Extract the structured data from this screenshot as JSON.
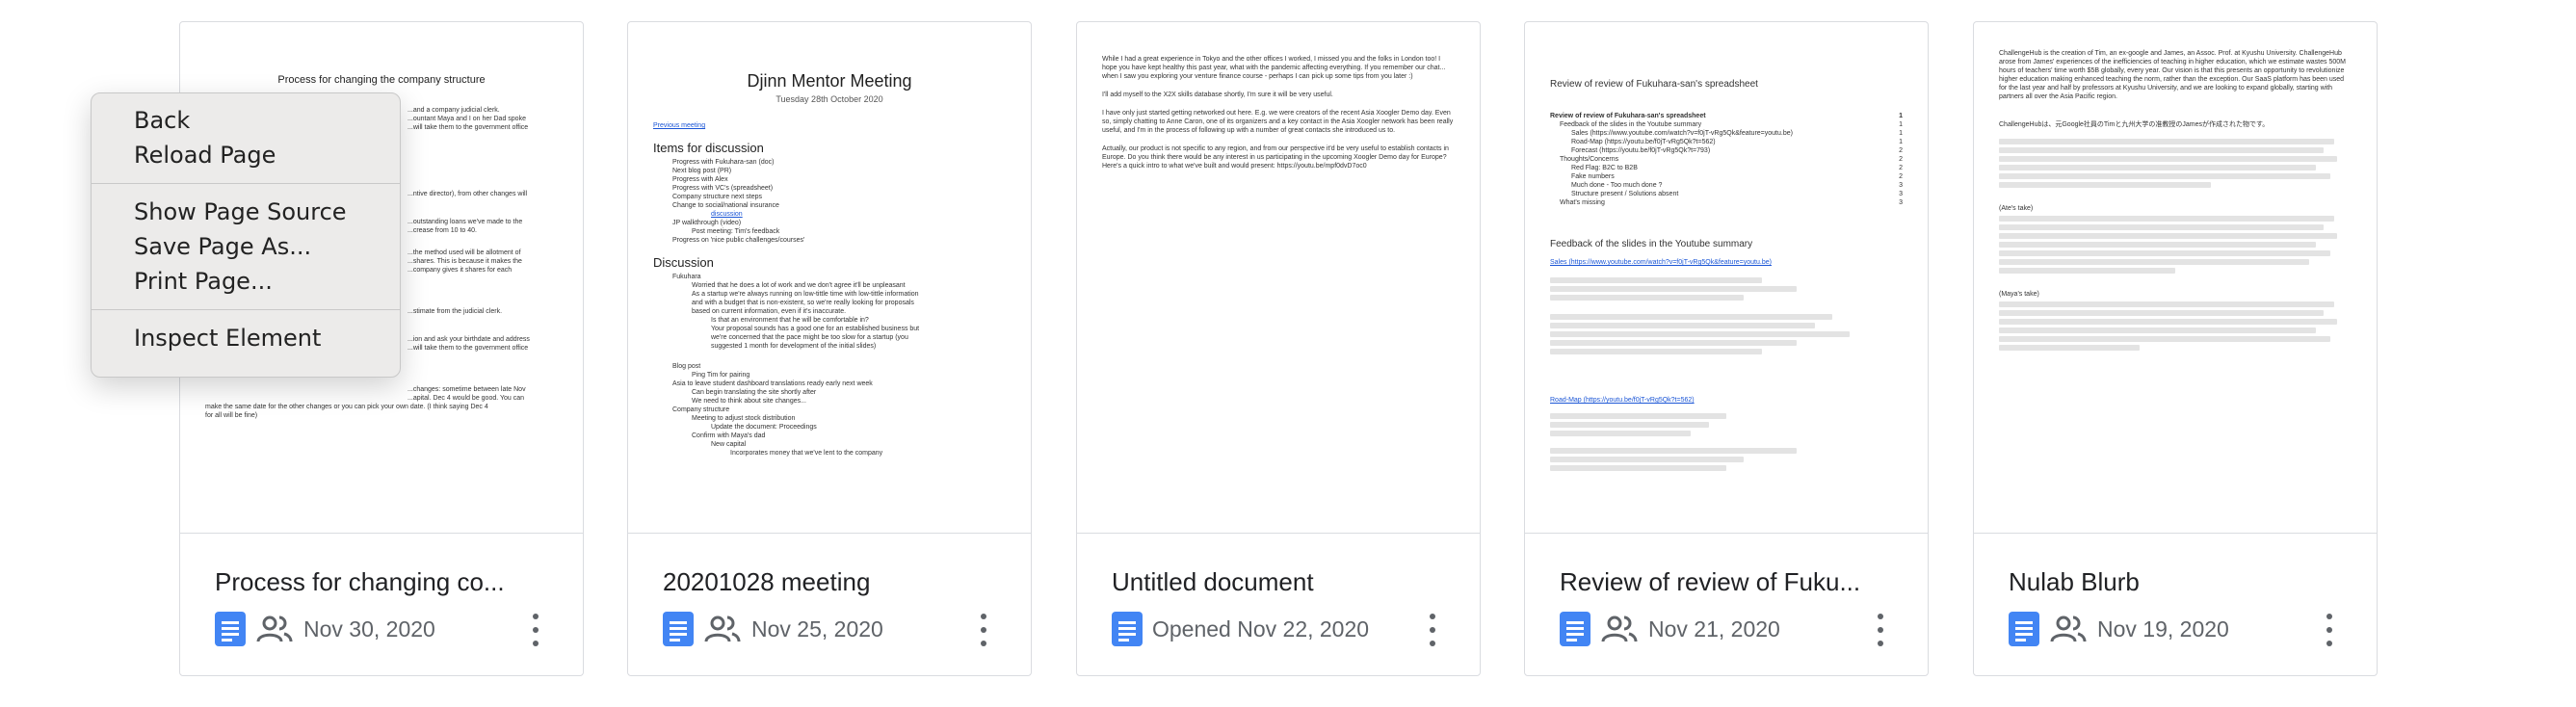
{
  "context_menu": {
    "items": [
      [
        "Back",
        "Reload Page"
      ],
      [
        "Show Page Source",
        "Save Page As...",
        "Print Page..."
      ],
      [
        "Inspect Element"
      ]
    ]
  },
  "cards": [
    {
      "title": "Process for changing co...",
      "shared": true,
      "meta": "Nov 30, 2020",
      "preview": {
        "title": "Process for changing the company structure",
        "lines": [
          "...and a company judicial clerk.",
          "...ountant Maya and I on her Dad spoke",
          "...will take them to the government office",
          "...ntive director), from other changes will",
          "...outstanding loans we've made to the",
          "...crease from 10 to 40.",
          "...the method used will be allotment of",
          "...shares. This is because it makes the",
          "...company gives it shares for each",
          "...stimate from the judicial clerk.",
          "...ion and ask your birthdate and address",
          "...will take them to the government office",
          "...changes: sometime between late Nov",
          "...apital. Dec 4 would be good. You can",
          "make the same date for the other changes or you can pick your own date. (I think saying Dec 4",
          "for all will be fine)"
        ]
      }
    },
    {
      "title": "20201028 meeting",
      "shared": true,
      "meta": "Nov 25, 2020",
      "preview": {
        "title": "Djinn Mentor Meeting",
        "subtitle": "Tuesday 28th October 2020",
        "link": "Previous meeting",
        "h1": "Items for discussion",
        "items": [
          "Progress with Fukuhara-san (doc)",
          "Next blog post (PR)",
          "Progress with Alex",
          "Progress with VC's (spreadsheet)",
          "Company structure next steps",
          "Change to social/national insurance",
          "discussion",
          "JP walkthrough (video)",
          "Post meeting: Tim's feedback",
          "Progress on 'nice public challenges/courses'"
        ],
        "h2": "Discussion",
        "discussion": [
          "Fukuhara",
          "Worried that he does a lot of work and we don't agree it'll be unpleasant",
          "As a startup we're always running on low-tittle time with low-tittle information",
          "and with a budget that is non-existent, so we're really looking for proposals",
          "based on current information, even if it's inaccurate.",
          "Is that an environment that he will be comfortable in?",
          "Your proposal sounds has a good one for an established business but",
          "we're concerned that the pace might be too slow for a startup (you",
          "suggested 1 month for development of the initial slides)",
          "Blog post",
          "Ping Tim for pairing",
          "Asia to leave student dashboard translations ready early next week",
          "Can begin translating the site shortly after",
          "We need to think about site changes...",
          "Company structure",
          "Meeting to adjust stock distribution",
          "Update the document: Proceedings",
          "Confirm with Maya's dad",
          "New capital",
          "Incorporates money that we've lent to the company"
        ]
      }
    },
    {
      "title": "Untitled document",
      "shared": false,
      "meta": "Opened Nov 22, 2020",
      "preview": {
        "paras": [
          "While I had a great experience in Tokyo and the other offices I worked, I missed you and the folks in London too! I hope you have kept healthy this past year, what with the pandemic affecting everything. If you remember our chat... when I saw you exploring your venture finance course - perhaps I can pick up some tips from you later :)",
          "I'll add myself to the X2X skills database shortly, I'm sure it will be very useful.",
          "I have only just started getting networked out here. E.g. we were creators of the recent Asia Xoogler Demo day. Even so, simply chatting to Anne Caron, one of its organizers and a key contact in the Asia Xoogler network has been really useful, and I'm in the process of following up with a number of great contacts she introduced us to.",
          "Actually, our product is not specific to any region, and from our perspective it'd be very useful to establish contacts in Europe. Do you think there would be any interest in us participating in the upcoming Xoogler Demo day for Europe? Here's a quick intro to what we've built and would present: https://youtu.be/mpf0dvD7oc0"
        ]
      }
    },
    {
      "title": "Review of review of Fuku...",
      "shared": true,
      "meta": "Nov 21, 2020",
      "preview": {
        "title": "Review of review of Fukuhara-san's spreadsheet",
        "rows": [
          [
            "Review of review of Fukuhara-san's spreadsheet",
            "1"
          ],
          [
            "Feedback of the slides in the Youtube summary",
            "1"
          ],
          [
            "Sales (https://www.youtube.com/watch?v=f0jT-vRg5Qk&feature=youtu.be)",
            "1"
          ],
          [
            "Road-Map (https://youtu.be/f0jT-vRg5Qk?t=562)",
            "1"
          ],
          [
            "Forecast (https://youtu.be/f0jT-vRg5Qk?t=793)",
            "2"
          ],
          [
            "Thoughts/Concerns",
            "2"
          ],
          [
            "Red Flag: B2C to B2B",
            "2"
          ],
          [
            "Fake numbers",
            "2"
          ],
          [
            "Much done - Too much done ?",
            "3"
          ],
          [
            "Structure present / Solutions absent",
            "3"
          ],
          [
            "What's missing",
            "3"
          ]
        ],
        "h1": "Feedback of the slides in the Youtube summary",
        "sales": "Sales (https://www.youtube.com/watch?v=f0jT-vRg5Qk&feature=youtu.be)",
        "roadmap": "Road-Map (https://youtu.be/f0jT-vRg5Qk?t=562)"
      }
    },
    {
      "title": "Nulab Blurb",
      "shared": true,
      "meta": "Nov 19, 2020",
      "preview": {
        "paras": [
          "ChallengeHub is the creation of Tim, an ex-google and James, an Assoc. Prof. at Kyushu University. ChallengeHub arose from James' experiences of the inefficiencies of teaching in higher education, which we estimate wastes 500M hours of teachers' time worth $5B globally, every year. Our vision is that this presents an opportunity to revolutionize higher education making enhanced teaching the norm, rather than the exception. Our SaaS platform has been used for the last year and half by professors at Kyushu University, and we are looking to expand globally, starting with partners all over the Asia Pacific region.",
          "ChallengeHubは、元Google社員のTimと九州大学の准教授のJamesが作成された物です。",
          "(Ate's take)",
          "(Maya's take)"
        ]
      }
    }
  ]
}
